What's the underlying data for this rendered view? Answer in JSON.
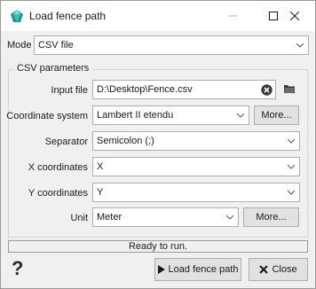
{
  "window": {
    "title": "Load fence path"
  },
  "mode": {
    "label": "Mode",
    "value": "CSV file"
  },
  "group": {
    "title": "CSV parameters"
  },
  "input_file": {
    "label": "Input file",
    "value": "D:\\Desktop\\Fence.csv"
  },
  "coordinate_system": {
    "label": "Coordinate system",
    "value": "Lambert II etendu",
    "more_label": "More..."
  },
  "separator": {
    "label": "Separator",
    "value": "Semicolon (;)"
  },
  "x_coordinates": {
    "label": "X coordinates",
    "value": "X"
  },
  "y_coordinates": {
    "label": "Y coordinates",
    "value": "Y"
  },
  "unit": {
    "label": "Unit",
    "value": "Meter",
    "more_label": "More..."
  },
  "status": {
    "text": "Ready to run."
  },
  "buttons": {
    "help": "?",
    "load": "Load fence path",
    "close": "Close"
  },
  "icons": {
    "app": "teal-gem-icon",
    "clear": "clear-circle-icon",
    "folder": "folder-icon",
    "play": "play-icon",
    "close_x": "close-x-icon"
  },
  "colors": {
    "accent_teal": "#1c9a8f",
    "window_bg": "#f0f0f0"
  }
}
